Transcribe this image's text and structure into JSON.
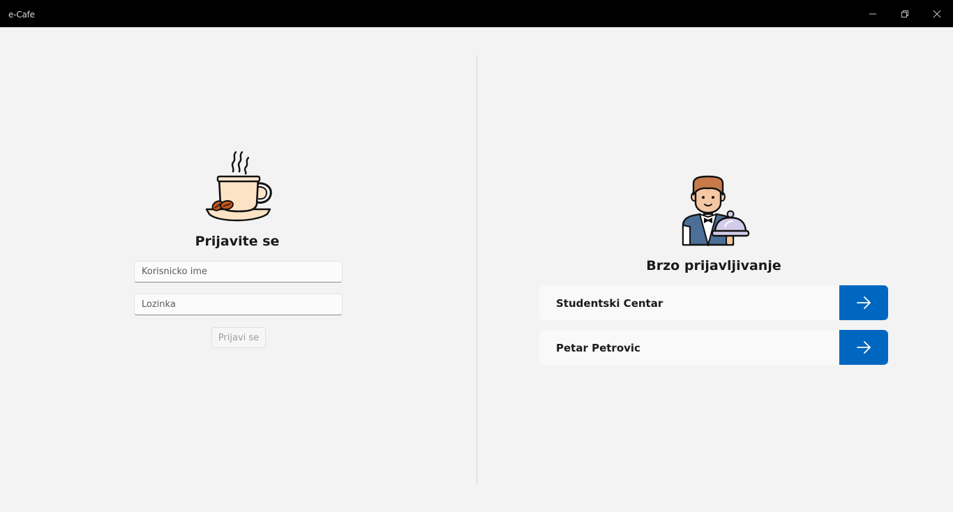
{
  "window": {
    "title": "e-Cafe",
    "controls": [
      "minimize-icon",
      "restore-icon",
      "close-icon"
    ]
  },
  "login": {
    "logo_icon": "coffee-cup-icon",
    "title": "Prijavite se",
    "username": {
      "placeholder": "Korisnicko ime",
      "value": ""
    },
    "password": {
      "placeholder": "Lozinka",
      "value": ""
    },
    "submit_label": "Prijavi se",
    "submit_enabled": false
  },
  "quick_login": {
    "logo_icon": "waiter-icon",
    "title": "Brzo prijavljivanje",
    "users": [
      {
        "name": "Studentski Centar",
        "action_icon": "arrow-right-icon"
      },
      {
        "name": "Petar Petrovic",
        "action_icon": "arrow-right-icon"
      }
    ]
  },
  "colors": {
    "accent": "#0067c0",
    "background": "#f3f3f3",
    "titlebar": "#000000"
  }
}
